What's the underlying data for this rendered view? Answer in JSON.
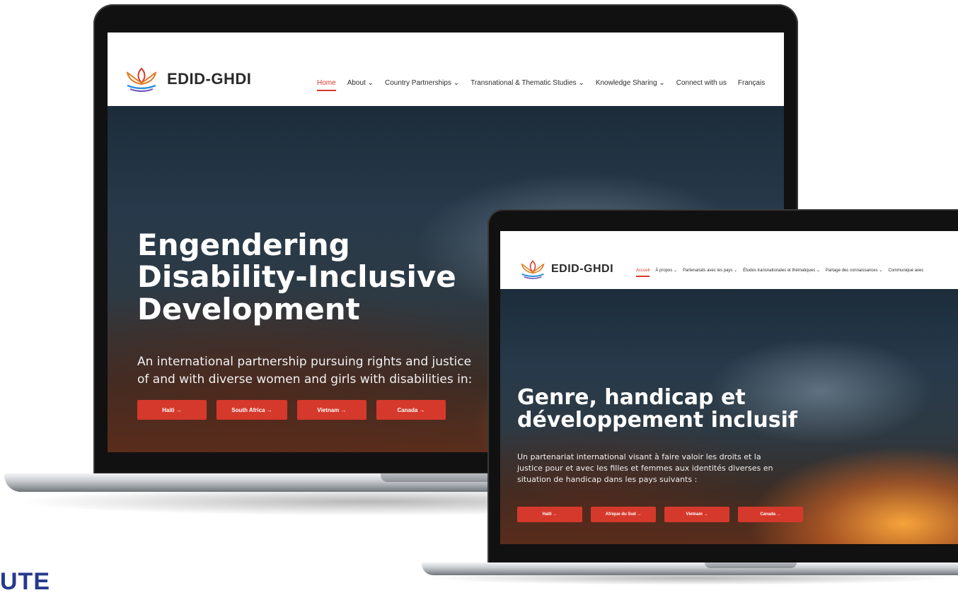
{
  "colors": {
    "accent": "#d5392b",
    "logo_text": "#2a2a2a",
    "bottom_text": "#243a8c"
  },
  "english_site": {
    "logo": {
      "icon": "lotus-logo-icon",
      "text": "EDID-GHDI"
    },
    "nav": [
      {
        "label": "Home",
        "active": true
      },
      {
        "label": "About",
        "dropdown": true
      },
      {
        "label": "Country Partnerships",
        "dropdown": true
      },
      {
        "label": "Transnational & Thematic Studies",
        "dropdown": true
      },
      {
        "label": "Knowledge Sharing",
        "dropdown": true
      },
      {
        "label": "Connect with us"
      },
      {
        "label": "Français"
      }
    ],
    "hero": {
      "title_lines": [
        "Engendering",
        "Disability-Inclusive",
        "Development"
      ],
      "subtitle_lines": [
        "An international partnership pursuing rights and justice",
        "of and with diverse women and girls with disabilities in:"
      ],
      "buttons": [
        "Haiti →",
        "South Africa →",
        "Vietnam →",
        "Canada →"
      ]
    }
  },
  "french_site": {
    "logo": {
      "icon": "lotus-logo-icon",
      "text": "EDID-GHDI"
    },
    "nav": [
      {
        "label": "Accueil",
        "active": true
      },
      {
        "label": "À propos",
        "dropdown": true
      },
      {
        "label": "Partenariats avec les pays",
        "dropdown": true
      },
      {
        "label": "Études transnationales et thématiques",
        "dropdown": true
      },
      {
        "label": "Partage des connaissances",
        "dropdown": true
      },
      {
        "label": "Communiqué avec"
      }
    ],
    "hero": {
      "title_lines": [
        "Genre, handicap et",
        "développement inclusif"
      ],
      "subtitle_lines": [
        "Un partenariat international visant à faire valoir les droits et la",
        "justice pour et avec les filles et femmes aux identités diverses en",
        "situation de handicap dans les pays suivants :"
      ],
      "buttons": [
        "Haïti →",
        "Afrique du Sud →",
        "Vietnam →",
        "Canada →"
      ]
    }
  },
  "page_corner_text": "UTE"
}
